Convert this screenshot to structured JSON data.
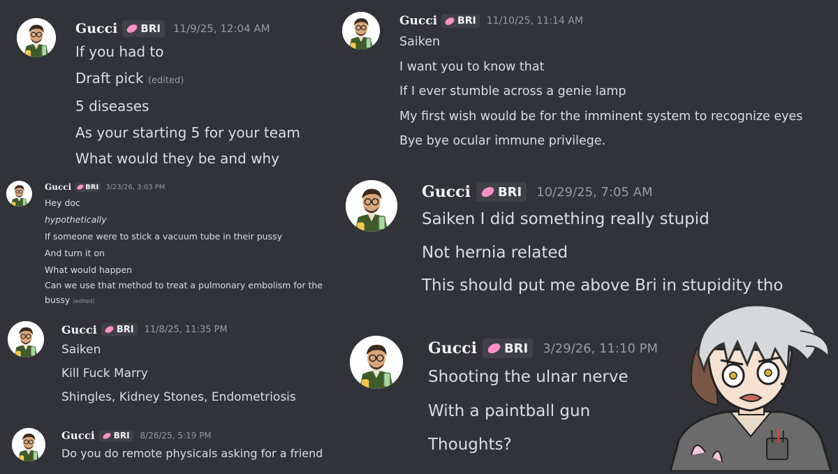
{
  "user": {
    "name": "Gucci",
    "tag": "BRI",
    "edited_label": "(edited)"
  },
  "icons": {
    "avatar": "user-avatar-icon",
    "tag_icon": "pink-bean-icon"
  },
  "colors": {
    "background": "#313338",
    "text": "#dbdee1",
    "timestamp": "#949ba4",
    "tag_bg": "#3f4147",
    "tag_icon": "#ff8fc7"
  },
  "messages": {
    "m1": {
      "timestamp": "11/9/25, 12:04 AM",
      "lines": [
        "If you had to",
        "Draft pick",
        "5 diseases",
        "As your starting 5 for your team",
        "What would they be and why"
      ]
    },
    "m2": {
      "timestamp": "3/23/26, 3:03 PM",
      "lines": [
        "Hey doc",
        "hypothetically",
        "If someone were to stick a vacuum tube in their pussy",
        "And turn it on",
        "What would happen",
        "Can we use that method to treat a pulmonary embolism for the",
        "bussy"
      ]
    },
    "m3": {
      "timestamp": "11/8/25, 11:35 PM",
      "lines": [
        "Saiken",
        "Kill Fuck Marry",
        "Shingles, Kidney Stones, Endometriosis"
      ]
    },
    "m4": {
      "timestamp": "8/26/25, 5:19 PM",
      "lines": [
        "Do you do remote physicals asking for a friend"
      ]
    },
    "m5": {
      "timestamp": "11/10/25, 11:14 AM",
      "lines": [
        "Saiken",
        "I want you to know that",
        "If I ever stumble across a genie lamp",
        "My first wish would be for the imminent system to recognize eyes",
        "Bye bye ocular immune privilege."
      ]
    },
    "m6": {
      "timestamp": "10/29/25, 7:05 AM",
      "lines": [
        "Saiken I did something really stupid",
        "Not hernia related",
        "This should put me above Bri in stupidity tho"
      ]
    },
    "m7": {
      "timestamp": "3/29/26, 11:10 PM",
      "lines": [
        "Shooting the ulnar nerve",
        "With a paintball gun",
        "Thoughts?"
      ]
    }
  }
}
